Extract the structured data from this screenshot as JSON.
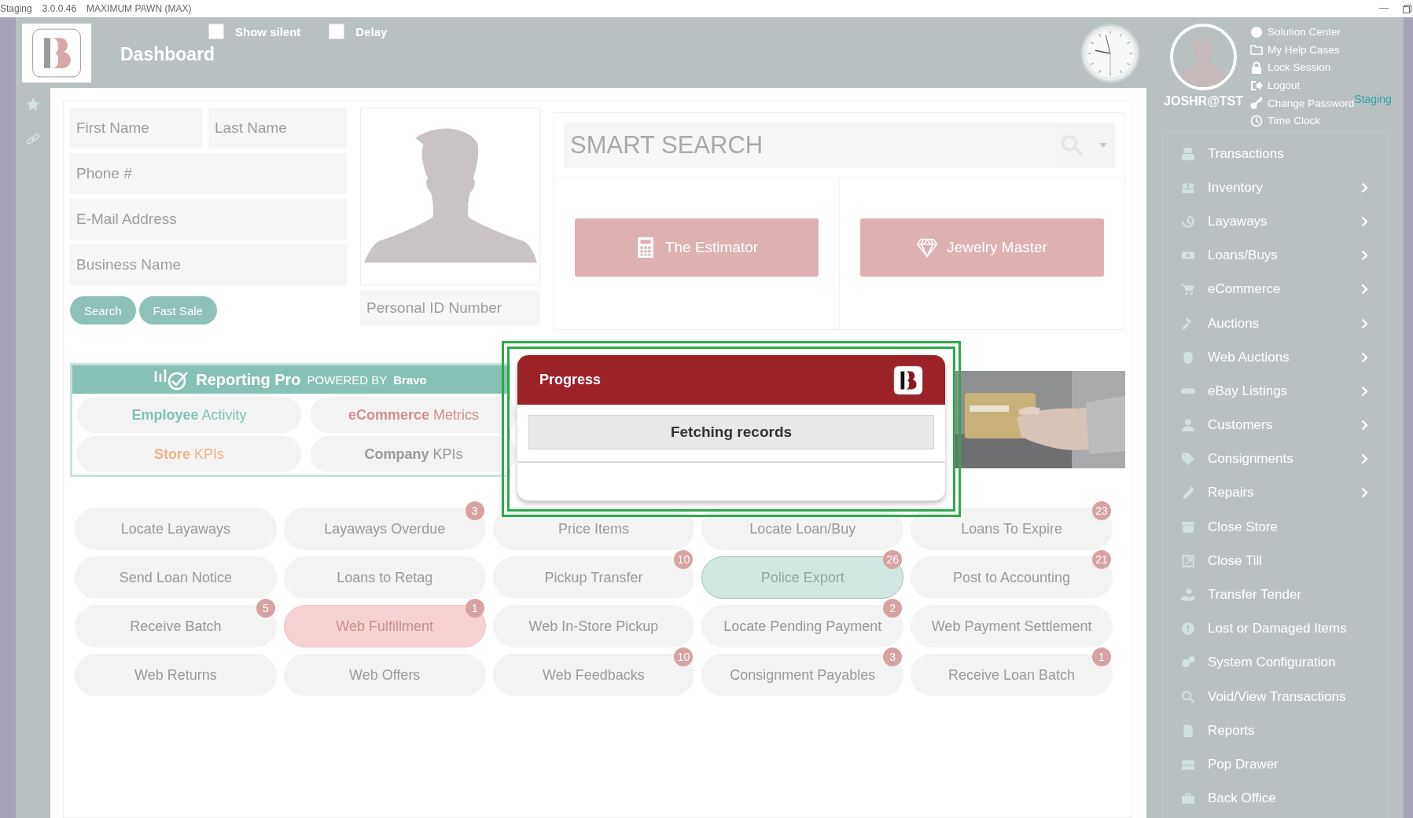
{
  "title_bar": {
    "app": "Staging",
    "version": "3.0.0.46",
    "store": "MAXIMUM PAWN (MAX)"
  },
  "header": {
    "title": "Dashboard",
    "options": [
      {
        "label": "Show silent",
        "checked": false
      },
      {
        "label": "Delay",
        "checked": false
      }
    ]
  },
  "customer_form": {
    "name_fields": [
      {
        "placeholder": "First Name"
      },
      {
        "placeholder": "Last Name"
      }
    ],
    "fields": [
      {
        "placeholder": "Phone #"
      },
      {
        "placeholder": "E-Mail Address"
      },
      {
        "placeholder": "Business Name"
      }
    ],
    "buttons": [
      "Search",
      "Fast Sale"
    ],
    "id_field": {
      "placeholder": "Personal ID Number"
    }
  },
  "smart_search": {
    "placeholder": "SMART SEARCH"
  },
  "tools": [
    {
      "label": "The Estimator"
    },
    {
      "label": "Jewelry Master"
    }
  ],
  "reporting": {
    "brand": "Reporting Pro",
    "tagline": "POWERED BY",
    "partner": "Bravo",
    "reports": [
      {
        "label": "**Employee** Activity",
        "color": "#7fc2b5"
      },
      {
        "label": "**eCommerce** Metrics",
        "color": "#d08f91"
      },
      {
        "label": "**Store** KPIs",
        "color": "#eeb48a"
      },
      {
        "label": "**Company** KPIs",
        "color": "#9a9a9a"
      }
    ]
  },
  "tiles": [
    {
      "label": "Locate Layaways",
      "selected": false,
      "alert": false
    },
    {
      "label": "Layaways Overdue",
      "selected": false,
      "alert": false,
      "badge": "3"
    },
    {
      "label": "Price Items",
      "selected": false,
      "alert": false
    },
    {
      "label": "Locate Loan/Buy",
      "selected": false,
      "alert": false
    },
    {
      "label": "Loans To Expire",
      "selected": false,
      "alert": false,
      "badge": "23"
    },
    {
      "label": "Send Loan Notice",
      "selected": false,
      "alert": false
    },
    {
      "label": "Loans to Retag",
      "selected": false,
      "alert": false
    },
    {
      "label": "Pickup Transfer",
      "selected": false,
      "alert": false,
      "badge": "10"
    },
    {
      "label": "Police Export",
      "selected": true,
      "alert": false,
      "badge": "26"
    },
    {
      "label": "Post to Accounting",
      "selected": false,
      "alert": false,
      "badge": "21"
    },
    {
      "label": "Receive Batch",
      "selected": false,
      "alert": false,
      "badge": "5"
    },
    {
      "label": "Web Fulfillment",
      "selected": false,
      "alert": true,
      "badge": "1"
    },
    {
      "label": "Web In-Store Pickup",
      "selected": false,
      "alert": false
    },
    {
      "label": "Locate Pending Payment",
      "selected": false,
      "alert": false,
      "badge": "2"
    },
    {
      "label": "Web Payment Settlement",
      "selected": false,
      "alert": false
    },
    {
      "label": "Web Returns",
      "selected": false,
      "alert": false
    },
    {
      "label": "Web Offers",
      "selected": false,
      "alert": false
    },
    {
      "label": "Web Feedbacks",
      "selected": false,
      "alert": false,
      "badge": "10"
    },
    {
      "label": "Consignment Payables",
      "selected": false,
      "alert": false,
      "badge": "3"
    },
    {
      "label": "Receive Loan Batch",
      "selected": false,
      "alert": false,
      "badge": "1"
    }
  ],
  "user": {
    "name": "JOSHR@TST",
    "environment": "Staging",
    "links": [
      {
        "label": "Solution Center"
      },
      {
        "label": "My Help Cases"
      },
      {
        "label": "Lock Session"
      },
      {
        "label": "Logout"
      },
      {
        "label": "Change Password"
      },
      {
        "label": "Time Clock"
      }
    ]
  },
  "menu": [
    {
      "label": "Transactions",
      "submenu": false
    },
    {
      "label": "Inventory",
      "submenu": true
    },
    {
      "label": "Layaways",
      "submenu": true
    },
    {
      "label": "Loans/Buys",
      "submenu": true
    },
    {
      "label": "eCommerce",
      "submenu": true
    },
    {
      "label": "Auctions",
      "submenu": true
    },
    {
      "label": "Web Auctions",
      "submenu": true
    },
    {
      "label": "eBay Listings",
      "submenu": true
    },
    {
      "label": "Customers",
      "submenu": true
    },
    {
      "label": "Consignments",
      "submenu": true
    },
    {
      "label": "Repairs",
      "submenu": true
    },
    {
      "label": "Close Store",
      "submenu": false
    },
    {
      "label": "Close Till",
      "submenu": false
    },
    {
      "label": "Transfer Tender",
      "submenu": false
    },
    {
      "label": "Lost or Damaged Items",
      "submenu": false
    },
    {
      "label": "System Configuration",
      "submenu": false
    },
    {
      "label": "Void/View Transactions",
      "submenu": false
    },
    {
      "label": "Reports",
      "submenu": false
    },
    {
      "label": "Pop Drawer",
      "submenu": false
    },
    {
      "label": "Back Office",
      "submenu": false
    }
  ],
  "dialog": {
    "title": "Progress",
    "message": "Fetching records"
  }
}
